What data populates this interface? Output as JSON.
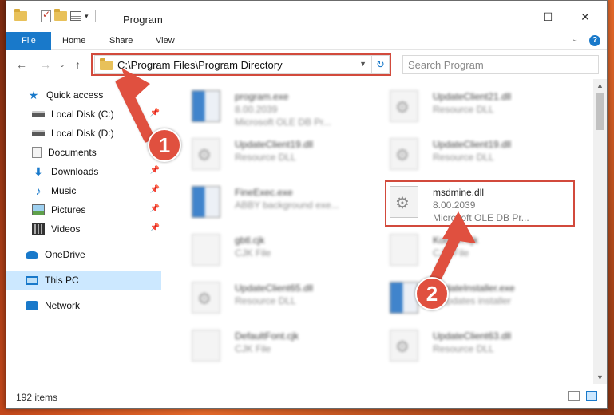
{
  "window": {
    "title": "Program",
    "controls": {
      "minimize": "—",
      "maximize": "☐",
      "close": "✕"
    }
  },
  "ribbon": {
    "tabs": [
      "File",
      "Home",
      "Share",
      "View"
    ],
    "help": "?",
    "expand": "⌄"
  },
  "nav": {
    "back": "←",
    "forward": "→",
    "recent": "⌄",
    "up": "↑",
    "address": "C:\\Program Files\\Program Directory",
    "refresh": "↻",
    "search_placeholder": "Search Program"
  },
  "sidebar": {
    "items": [
      {
        "label": "Quick access",
        "icon": "star-icon"
      },
      {
        "label": "Local Disk (C:)",
        "icon": "disk-icon"
      },
      {
        "label": "Local Disk (D:)",
        "icon": "disk-icon"
      },
      {
        "label": "Documents",
        "icon": "documents-icon"
      },
      {
        "label": "Downloads",
        "icon": "downloads-icon"
      },
      {
        "label": "Music",
        "icon": "music-icon"
      },
      {
        "label": "Pictures",
        "icon": "pictures-icon"
      },
      {
        "label": "Videos",
        "icon": "videos-icon"
      },
      {
        "label": "OneDrive",
        "icon": "onedrive-icon"
      },
      {
        "label": "This PC",
        "icon": "this-pc-icon"
      },
      {
        "label": "Network",
        "icon": "network-icon"
      }
    ]
  },
  "files": [
    {
      "name": "program.exe",
      "line2": "8.00.2039",
      "line3": "Microsoft OLE DB Pr..."
    },
    {
      "name": "UpdateClient21.dll",
      "line2": "Resource DLL",
      "line3": ""
    },
    {
      "name": "UpdateClient19.dll",
      "line2": "Resource DLL",
      "line3": ""
    },
    {
      "name": "UpdateClient19.dll",
      "line2": "Resource DLL",
      "line3": ""
    },
    {
      "name": "FineExec.exe",
      "line2": "ABBY background exe...",
      "line3": ""
    },
    {
      "name": "msdmine.dll",
      "line2": "8.00.2039",
      "line3": "Microsoft OLE DB Pr..."
    },
    {
      "name": "gbtl.cjk",
      "line2": "CJK File",
      "line3": ""
    },
    {
      "name": "Korean.cjk",
      "line2": "CJK File",
      "line3": ""
    },
    {
      "name": "UpdateClient65.dll",
      "line2": "Resource DLL",
      "line3": ""
    },
    {
      "name": "UpdateInstaller.exe",
      "line2": "F updates installer",
      "line3": ""
    },
    {
      "name": "DefaultFont.cjk",
      "line2": "CJK File",
      "line3": ""
    },
    {
      "name": "UpdateClient63.dll",
      "line2": "Resource DLL",
      "line3": ""
    }
  ],
  "status": {
    "count": "192 items"
  },
  "annotations": {
    "step1": "1",
    "step2": "2",
    "color": "#e0503f"
  }
}
